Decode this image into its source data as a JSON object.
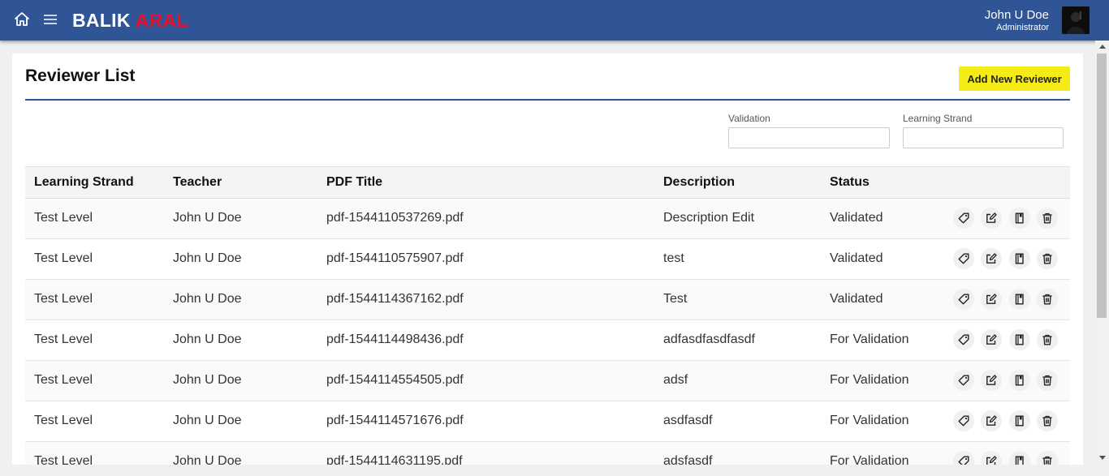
{
  "header": {
    "brand_white": "BALIK",
    "brand_red": "ARAL",
    "user_name": "John U Doe",
    "user_role": "Administrator",
    "icons": [
      "home-icon",
      "hamburger-menu-icon"
    ],
    "bar_color": "#2f5596",
    "brand_accent": "#e8102a"
  },
  "page": {
    "title": "Reviewer List",
    "add_button": "Add New Reviewer",
    "add_button_color": "#f5ec16"
  },
  "filters": {
    "validation_label": "Validation",
    "validation_value": "",
    "strand_label": "Learning Strand",
    "strand_value": ""
  },
  "table": {
    "columns": [
      "Learning Strand",
      "Teacher",
      "PDF Title",
      "Description",
      "Status"
    ],
    "action_icons": [
      "tag-icon",
      "edit-icon",
      "book-icon",
      "trash-icon"
    ],
    "rows": [
      {
        "strand": "Test Level",
        "teacher": "John U Doe",
        "pdf": "pdf-1544110537269.pdf",
        "description": "Description Edit",
        "status": "Validated"
      },
      {
        "strand": "Test Level",
        "teacher": "John U Doe",
        "pdf": "pdf-1544110575907.pdf",
        "description": "test",
        "status": "Validated"
      },
      {
        "strand": "Test Level",
        "teacher": "John U Doe",
        "pdf": "pdf-1544114367162.pdf",
        "description": "Test",
        "status": "Validated"
      },
      {
        "strand": "Test Level",
        "teacher": "John U Doe",
        "pdf": "pdf-1544114498436.pdf",
        "description": "adfasdfasdfasdf",
        "status": "For Validation"
      },
      {
        "strand": "Test Level",
        "teacher": "John U Doe",
        "pdf": "pdf-1544114554505.pdf",
        "description": "adsf",
        "status": "For Validation"
      },
      {
        "strand": "Test Level",
        "teacher": "John U Doe",
        "pdf": "pdf-1544114571676.pdf",
        "description": "asdfasdf",
        "status": "For Validation"
      },
      {
        "strand": "Test Level",
        "teacher": "John U Doe",
        "pdf": "pdf-1544114631195.pdf",
        "description": "adsfasdf",
        "status": "For Validation"
      }
    ]
  }
}
